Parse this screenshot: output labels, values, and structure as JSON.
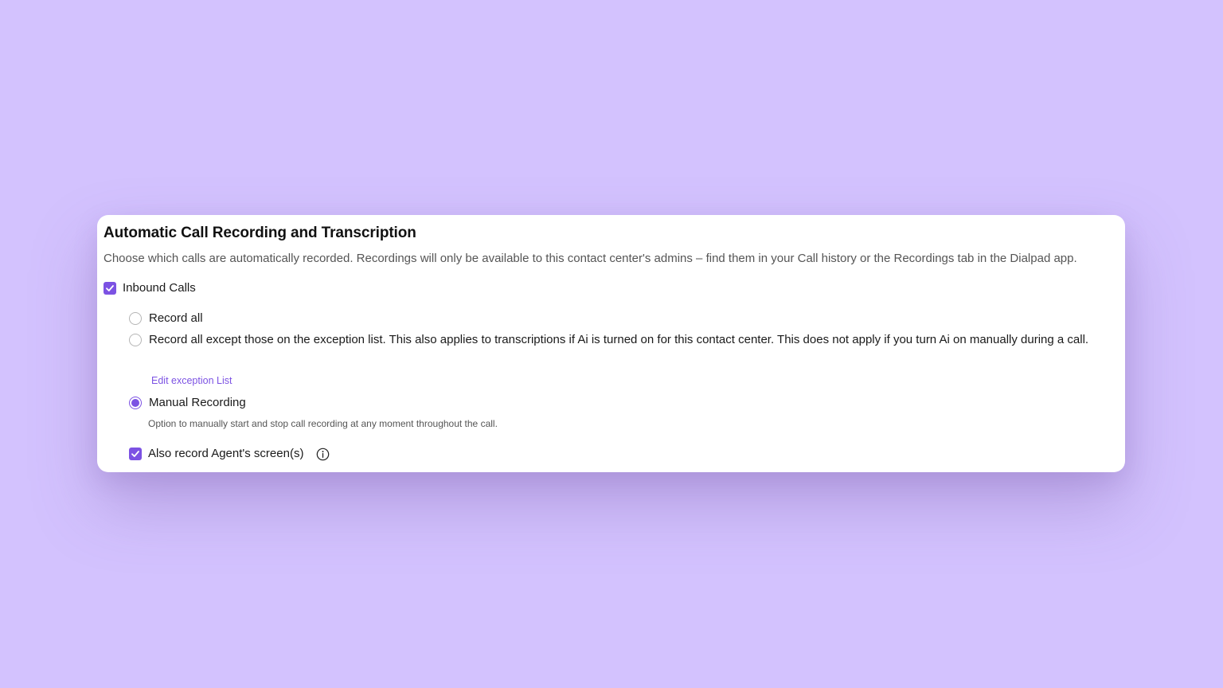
{
  "section": {
    "title": "Automatic Call Recording and Transcription",
    "description": "Choose which calls are automatically recorded. Recordings will only be available to this contact center's admins – find them in your Call history or the Recordings tab in the Dialpad app."
  },
  "inbound": {
    "label": "Inbound Calls",
    "checked": true
  },
  "options": {
    "record_all": {
      "label": "Record all",
      "selected": false
    },
    "record_except": {
      "label": "Record all except those on the exception list. This also applies to transcriptions if Ai is turned on for this contact center. This does not apply if you turn Ai on manually during a call.",
      "selected": false,
      "link_label": "Edit exception List"
    },
    "manual": {
      "label": "Manual Recording",
      "selected": true,
      "hint": "Option to manually start and stop call recording at any moment throughout the call."
    }
  },
  "agent_screen": {
    "label": "Also record Agent's screen(s)",
    "checked": true,
    "icon": "info-icon"
  },
  "colors": {
    "accent": "#7c52e3",
    "background": "#d3c2fe",
    "card": "#ffffff"
  }
}
